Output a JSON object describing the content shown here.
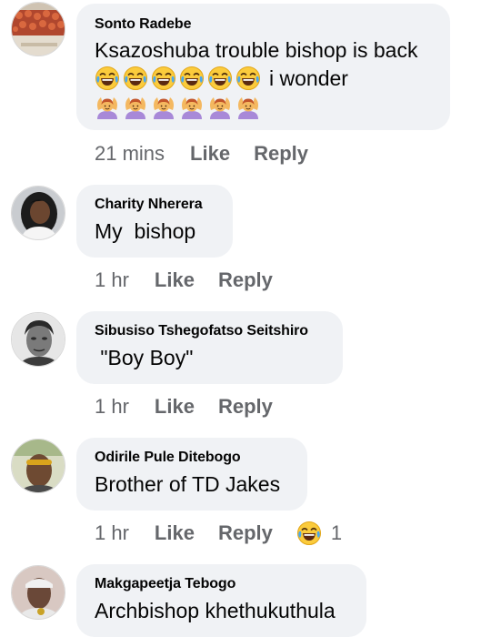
{
  "comments": [
    {
      "author": "Sonto Radebe",
      "text_line1": "Ksazoshuba trouble bishop is back",
      "text_line2_suffix": "i wonder",
      "laugh_emoji_count": 6,
      "woman_gesture_emoji_count": 6,
      "time": "21 mins",
      "like_label": "Like",
      "reply_label": "Reply"
    },
    {
      "author": "Charity Nherera",
      "text": "My  bishop",
      "time": "1 hr",
      "like_label": "Like",
      "reply_label": "Reply"
    },
    {
      "author": "Sibusiso Tshegofatso Seitshiro",
      "text": " \"Boy Boy\"",
      "time": "1 hr",
      "like_label": "Like",
      "reply_label": "Reply"
    },
    {
      "author": "Odirile Pule Ditebogo",
      "text": "Brother of TD Jakes",
      "time": "1 hr",
      "like_label": "Like",
      "reply_label": "Reply",
      "reaction_count": "1",
      "reaction_icon": "laughing-emoji-icon"
    },
    {
      "author": "Makgapeetja Tebogo",
      "text": "Archbishop khethukuthula"
    }
  ],
  "colors": {
    "bubble": "#f0f2f5",
    "meta_text": "#65676b",
    "body_text": "#050505",
    "emoji_yellow": "#fbcb3c",
    "gesture_purple": "#a889d8"
  }
}
